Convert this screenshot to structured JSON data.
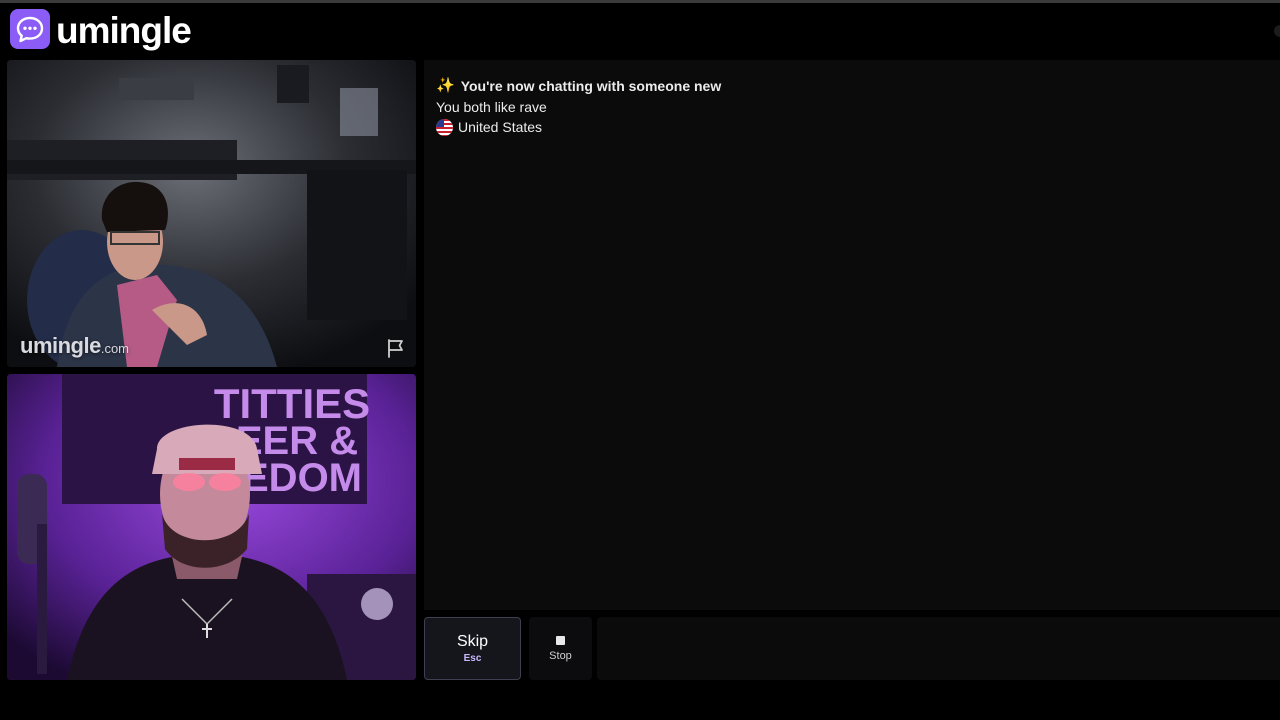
{
  "app": {
    "brand": "umingle",
    "brand_color": "#8b5cf6"
  },
  "remote_video": {
    "watermark_name": "umingle",
    "watermark_suffix": ".com",
    "report_icon": "flag-icon"
  },
  "local_video": {
    "banner_text_line1": "TITTIES",
    "banner_text_line2": "EER &",
    "banner_text_line3": "EDOM"
  },
  "chat": {
    "title": "You're now chatting with someone new",
    "title_icon": "sparkles-icon",
    "common_interest": "You both like rave",
    "country": "United States",
    "country_icon": "us-flag-icon"
  },
  "controls": {
    "skip_label": "Skip",
    "skip_shortcut": "Esc",
    "stop_label": "Stop",
    "message_placeholder": ""
  }
}
